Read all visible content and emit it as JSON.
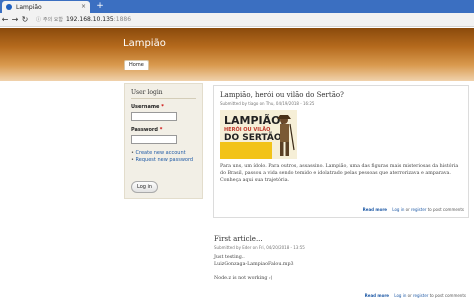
{
  "browser": {
    "tab_title": "Lampião",
    "tab_close": "×",
    "new_tab": "+",
    "nav_back": "←",
    "nav_forward": "→",
    "nav_reload": "↻",
    "security_label": "주의 요함",
    "url_host": "192.168.10.135",
    "url_port": ":1886"
  },
  "header": {
    "site_name": "Lampião",
    "nav_home": "Home"
  },
  "sidebar": {
    "title": "User login",
    "username_label": "Username",
    "password_label": "Password",
    "required_mark": "*",
    "create_account": "Create new account",
    "request_password": "Request new password",
    "login_button": "Log in"
  },
  "article1": {
    "title": "Lampião, herói ou vilão do Sertão?",
    "meta": "Submitted by tiago on Thu, 04/19/2018 - 16:25",
    "image_text_1": "LAMPIÃO,",
    "image_text_2": "HERÓI OU VILÃO",
    "image_text_3": "DO SERTÃO",
    "body": "Para uns, um ídolo. Para outros, assassino. Lampião, uma das figuras mais misteriosas da história do Brasil, passou a vida sendo temido e idolatrado pelas pessoas que aterrorizava e amparava. Conheça aqui sua trajetória.",
    "read_more": "Read more",
    "login_link": "Log in",
    "or_text": " or ",
    "register_link": "register",
    "post_text": " to post comments"
  },
  "article2": {
    "title": "First article...",
    "meta": "Submitted by Eder on Fri, 04/20/2018 - 13:55",
    "line1": "Just testing..",
    "line2": "LuizGonzaga-LampiaoFalou.mp3",
    "line3": "Node.z is not working :(",
    "read_more": "Read more",
    "login_link": "Log in",
    "or_text": " or ",
    "register_link": "register",
    "post_text": " to post comments"
  },
  "colors": {
    "header_dark": "#8a4a0c",
    "header_light": "#f0d2ac",
    "link": "#1f5aa6",
    "tab_bar": "#3b6fc1"
  }
}
